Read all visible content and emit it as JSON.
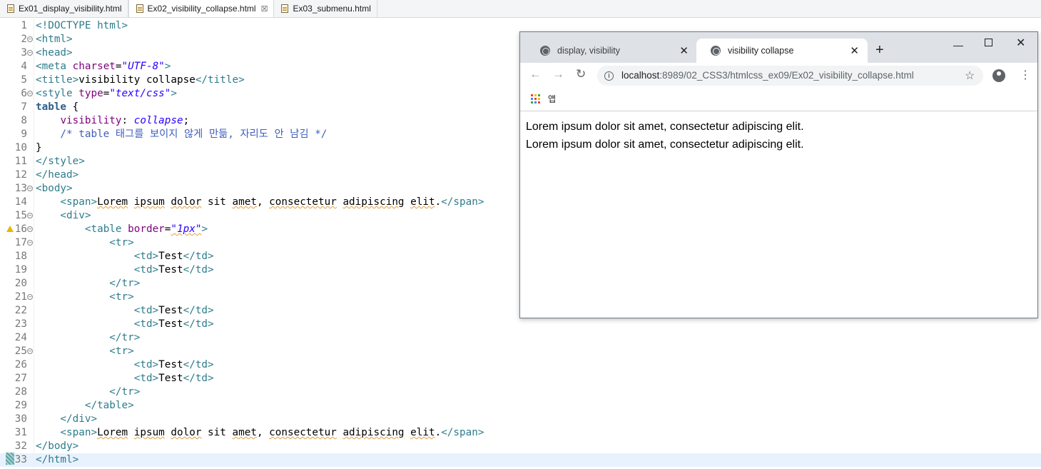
{
  "editor_tabs": [
    {
      "label": "Ex01_display_visibility.html"
    },
    {
      "label": "Ex02_visibility_collapse.html"
    },
    {
      "label": "Ex03_submenu.html"
    }
  ],
  "editor_close_glyph": "☒",
  "line_numbers": [
    "1",
    "2",
    "3",
    "4",
    "5",
    "6",
    "7",
    "8",
    "9",
    "10",
    "11",
    "12",
    "13",
    "14",
    "15",
    "16",
    "17",
    "18",
    "19",
    "20",
    "21",
    "22",
    "23",
    "24",
    "25",
    "26",
    "27",
    "28",
    "29",
    "30",
    "31",
    "32",
    "33"
  ],
  "code_lines": [
    "<!DOCTYPE html>",
    "<html>",
    "<head>",
    "<meta charset=\"UTF-8\">",
    "<title>visibility collapse</title>",
    "<style type=\"text/css\">",
    "table {",
    "    visibility: collapse;",
    "    /* table 태그를 보이지 않게 만듦, 자리도 안 남김 */",
    "}",
    "</style>",
    "</head>",
    "<body>",
    "    <span>Lorem ipsum dolor sit amet, consectetur adipiscing elit.</span>",
    "    <div>",
    "        <table border=\"1px\">",
    "            <tr>",
    "                <td>Test</td>",
    "                <td>Test</td>",
    "            </tr>",
    "            <tr>",
    "                <td>Test</td>",
    "                <td>Test</td>",
    "            </tr>",
    "            <tr>",
    "                <td>Test</td>",
    "                <td>Test</td>",
    "            </tr>",
    "        </table>",
    "    </div>",
    "    <span>Lorem ipsum dolor sit amet, consectetur adipiscing elit.</span>",
    "</body>",
    "</html>"
  ],
  "browser": {
    "tabs": [
      {
        "label": "display, visibility",
        "close": "✕"
      },
      {
        "label": "visibility collapse",
        "close": "✕"
      }
    ],
    "new_tab": "+",
    "window_controls": {
      "minimize": "—",
      "close": "✕"
    },
    "nav": {
      "back": "←",
      "forward": "→",
      "reload": "↻"
    },
    "info_glyph": "i",
    "address": {
      "host": "localhost",
      "path": ":8989/02_CSS3/htmlcss_ex09/Ex02_visibility_collapse.html"
    },
    "star_glyph": "☆",
    "menu_glyph": "⋮",
    "bookmarks": {
      "apps_label": "앱"
    },
    "content": [
      "Lorem ipsum dolor sit amet, consectetur adipiscing elit.",
      "Lorem ipsum dolor sit amet, consectetur adipiscing elit."
    ]
  },
  "colors": {
    "tag": "#2e7c8c",
    "attribute": "#7f007f",
    "value": "#2a00ff",
    "comment": "#3f5fbf",
    "current_line": "#e8f2fe",
    "browser_tabstrip": "#dee1e6"
  }
}
